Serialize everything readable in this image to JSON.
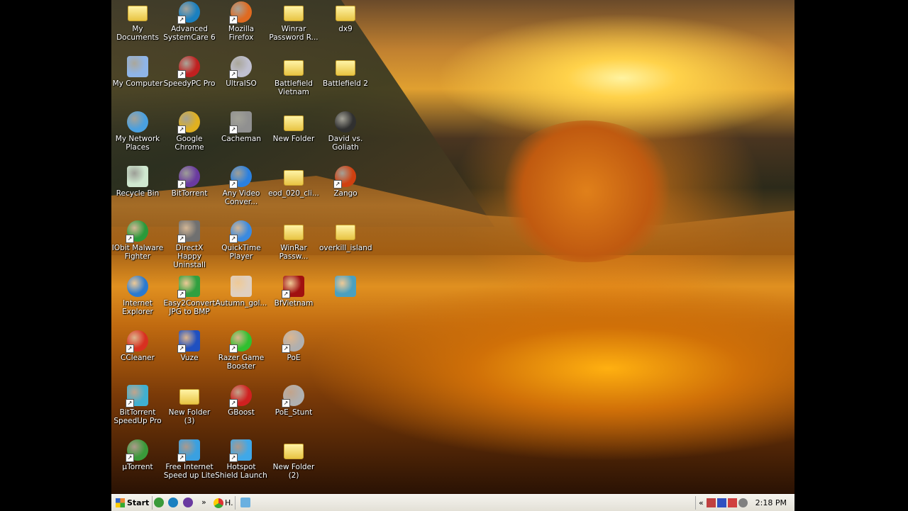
{
  "desktop": {
    "columns": [
      [
        {
          "label": "My Documents",
          "icon": "documents-icon",
          "type": "folder",
          "color": "#f0d060",
          "shortcut": false
        },
        {
          "label": "My Computer",
          "icon": "computer-icon",
          "type": "square",
          "color": "#8fb5e8",
          "shortcut": false
        },
        {
          "label": "My Network Places",
          "icon": "network-icon",
          "type": "round",
          "color": "#4aa0e0",
          "shortcut": false
        },
        {
          "label": "Recycle Bin",
          "icon": "recycle-bin-icon",
          "type": "square",
          "color": "#cfe8cf",
          "shortcut": false
        },
        {
          "label": "IObit Malware Fighter",
          "icon": "iobit-icon",
          "type": "round",
          "color": "#2a9a3a",
          "shortcut": true
        },
        {
          "label": "Internet Explorer",
          "icon": "internet-explorer-icon",
          "type": "round",
          "color": "#2a7ad0",
          "shortcut": false
        },
        {
          "label": "CCleaner",
          "icon": "ccleaner-icon",
          "type": "round",
          "color": "#d83020",
          "shortcut": true
        },
        {
          "label": "BitTorrent SpeedUp Pro",
          "icon": "speedup-icon",
          "type": "square",
          "color": "#40b0d0",
          "shortcut": true
        },
        {
          "label": "µTorrent",
          "icon": "utorrent-icon",
          "type": "round",
          "color": "#3a9a3a",
          "shortcut": true
        }
      ],
      [
        {
          "label": "Advanced SystemCare 6",
          "icon": "systemcare-icon",
          "type": "round",
          "color": "#1a80c0",
          "shortcut": true
        },
        {
          "label": "SpeedyPC Pro",
          "icon": "speedypc-icon",
          "type": "round",
          "color": "#c02020",
          "shortcut": true
        },
        {
          "label": "Google Chrome",
          "icon": "chrome-icon",
          "type": "round",
          "color": "#e0b020",
          "shortcut": true
        },
        {
          "label": "BitTorrent",
          "icon": "bittorrent-icon",
          "type": "round",
          "color": "#6a3aa0",
          "shortcut": true
        },
        {
          "label": "DirectX Happy Uninstall",
          "icon": "directx-icon",
          "type": "square",
          "color": "#707070",
          "shortcut": true
        },
        {
          "label": "Easy2Convert JPG to BMP",
          "icon": "easy2convert-icon",
          "type": "square",
          "color": "#30a040",
          "shortcut": true
        },
        {
          "label": "Vuze",
          "icon": "vuze-icon",
          "type": "square",
          "color": "#2050c0",
          "shortcut": true
        },
        {
          "label": "New Folder (3)",
          "icon": "folder-icon",
          "type": "folder",
          "color": "#f0d060",
          "shortcut": false
        },
        {
          "label": "Free Internet Speed up Lite",
          "icon": "speedup-lite-icon",
          "type": "square",
          "color": "#3aa0e0",
          "shortcut": true
        }
      ],
      [
        {
          "label": "Mozilla Firefox",
          "icon": "firefox-icon",
          "type": "round",
          "color": "#e06a20",
          "shortcut": true
        },
        {
          "label": "UltraISO",
          "icon": "ultraiso-icon",
          "type": "round",
          "color": "#c0c0d0",
          "shortcut": true
        },
        {
          "label": "Cacheman",
          "icon": "cacheman-icon",
          "type": "square",
          "color": "#909090",
          "shortcut": true
        },
        {
          "label": "Any Video Conver...",
          "icon": "video-converter-icon",
          "type": "round",
          "color": "#2a80e0",
          "shortcut": true
        },
        {
          "label": "QuickTime Player",
          "icon": "quicktime-icon",
          "type": "round",
          "color": "#3a8ae0",
          "shortcut": true
        },
        {
          "label": "Autumn_gol...",
          "icon": "image-file-icon",
          "type": "square",
          "color": "#e0d0c0",
          "shortcut": false
        },
        {
          "label": "Razer Game Booster",
          "icon": "razer-icon",
          "type": "round",
          "color": "#30c030",
          "shortcut": true
        },
        {
          "label": "GBoost",
          "icon": "gboost-icon",
          "type": "round",
          "color": "#d02020",
          "shortcut": true
        },
        {
          "label": "Hotspot Shield Launch",
          "icon": "hotspot-shield-icon",
          "type": "square",
          "color": "#40a8e8",
          "shortcut": true
        }
      ],
      [
        {
          "label": "Winrar Password R...",
          "icon": "folder-icon",
          "type": "folder",
          "color": "#f0d060",
          "shortcut": false
        },
        {
          "label": "Battlefield Vietnam",
          "icon": "folder-icon",
          "type": "folder",
          "color": "#f0d060",
          "shortcut": false
        },
        {
          "label": "New Folder",
          "icon": "folder-icon",
          "type": "folder",
          "color": "#f0d060",
          "shortcut": false
        },
        {
          "label": "eod_020_cli...",
          "icon": "folder-icon",
          "type": "folder",
          "color": "#f0d060",
          "shortcut": false
        },
        {
          "label": "WinRar Passw...",
          "icon": "folder-icon",
          "type": "folder",
          "color": "#f0d060",
          "shortcut": false
        },
        {
          "label": "BfVietnam",
          "icon": "bfvietnam-icon",
          "type": "square",
          "color": "#a01010",
          "shortcut": true
        },
        {
          "label": "PoE",
          "icon": "poe-icon",
          "type": "round",
          "color": "#b0b0b0",
          "shortcut": true
        },
        {
          "label": "PoE_Stunt",
          "icon": "poe-stunt-icon",
          "type": "round",
          "color": "#b0b0b0",
          "shortcut": true
        },
        {
          "label": "New Folder (2)",
          "icon": "folder-icon",
          "type": "folder",
          "color": "#f0d060",
          "shortcut": false
        }
      ],
      [
        {
          "label": "dx9",
          "icon": "folder-icon",
          "type": "folder",
          "color": "#f0d060",
          "shortcut": false
        },
        {
          "label": "Battlefield 2",
          "icon": "folder-icon",
          "type": "folder",
          "color": "#f0d060",
          "shortcut": false
        },
        {
          "label": "David vs. Goliath",
          "icon": "character-icon",
          "type": "round",
          "color": "#303030",
          "shortcut": false
        },
        {
          "label": "Zango",
          "icon": "zango-icon",
          "type": "round",
          "color": "#d04010",
          "shortcut": true
        },
        {
          "label": "overkill_island",
          "icon": "folder-icon",
          "type": "folder",
          "color": "#f0d060",
          "shortcut": false
        },
        {
          "label": "",
          "icon": "installer-icon",
          "type": "square",
          "color": "#4aa0c0",
          "shortcut": false
        }
      ]
    ]
  },
  "taskbar": {
    "start_label": "Start",
    "quick_launch_more": "»",
    "task_label": "H.",
    "tray_expand": "«",
    "clock": "2:18 PM"
  }
}
